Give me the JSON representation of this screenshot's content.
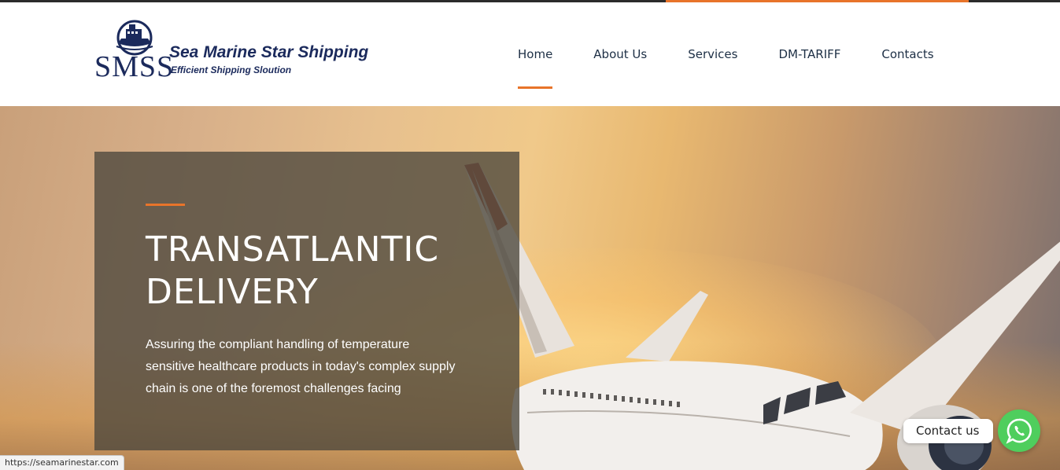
{
  "brand": {
    "emblem_text": "SMSS",
    "name": "Sea Marine Star Shipping",
    "tagline": "Efficient Shipping Sloution"
  },
  "nav": {
    "items": [
      {
        "label": "Home",
        "active": true
      },
      {
        "label": "About Us",
        "active": false
      },
      {
        "label": "Services",
        "active": false
      },
      {
        "label": "DM-TARIFF",
        "active": false
      },
      {
        "label": "Contacts",
        "active": false
      }
    ]
  },
  "hero": {
    "title_line1": "TRANSATLANTIC",
    "title_line2": "DELIVERY",
    "text": "Assuring the compliant handling of temperature sensitive healthcare products in today's complex supply chain is one of the foremost challenges facing"
  },
  "status_url": "https://seamarinestar.com",
  "contact_widget": {
    "label": "Contact us",
    "icon": "whatsapp-icon"
  },
  "colors": {
    "accent": "#e8742a",
    "brand_navy": "#1b2a5c",
    "nav_text": "#1d2f45",
    "whatsapp_green": "#4fce5d"
  }
}
